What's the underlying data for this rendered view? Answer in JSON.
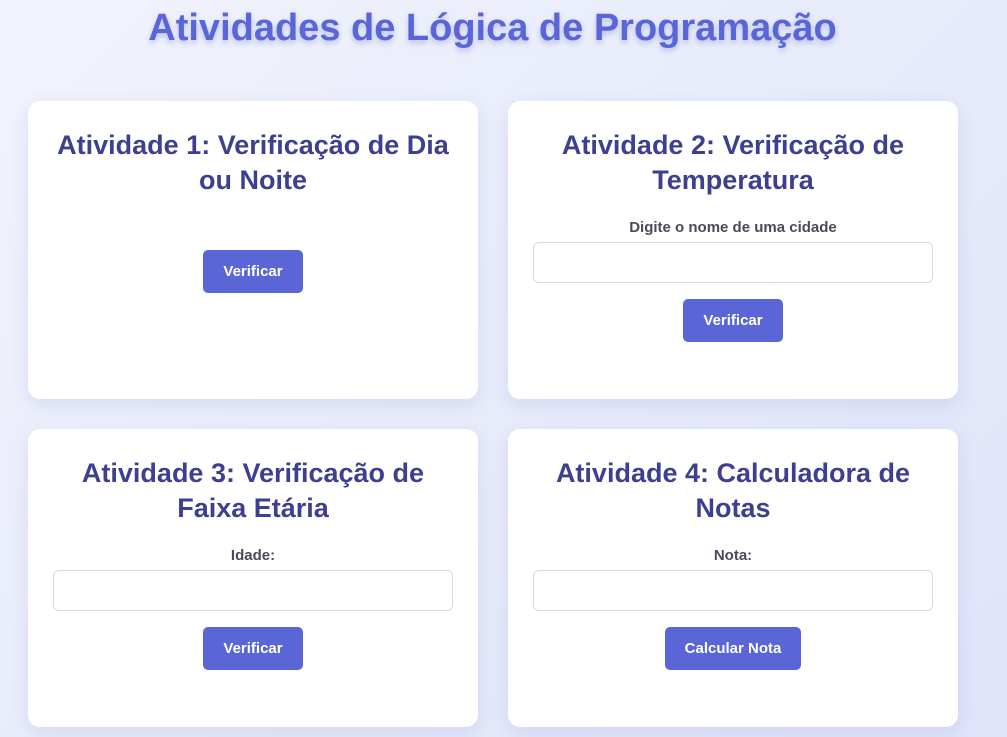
{
  "page": {
    "title": "Atividades de Lógica de Programação"
  },
  "cards": [
    {
      "title": "Atividade 1: Verificação de Dia ou Noite",
      "button": "Verificar"
    },
    {
      "title": "Atividade 2: Verificação de Temperatura",
      "label": "Digite o nome de uma cidade",
      "input_value": "",
      "button": "Verificar"
    },
    {
      "title": "Atividade 3: Verificação de Faixa Etária",
      "label": "Idade:",
      "input_value": "",
      "button": "Verificar"
    },
    {
      "title": "Atividade 4: Calculadora de Notas",
      "label": "Nota:",
      "input_value": "",
      "button": "Calcular Nota"
    }
  ]
}
